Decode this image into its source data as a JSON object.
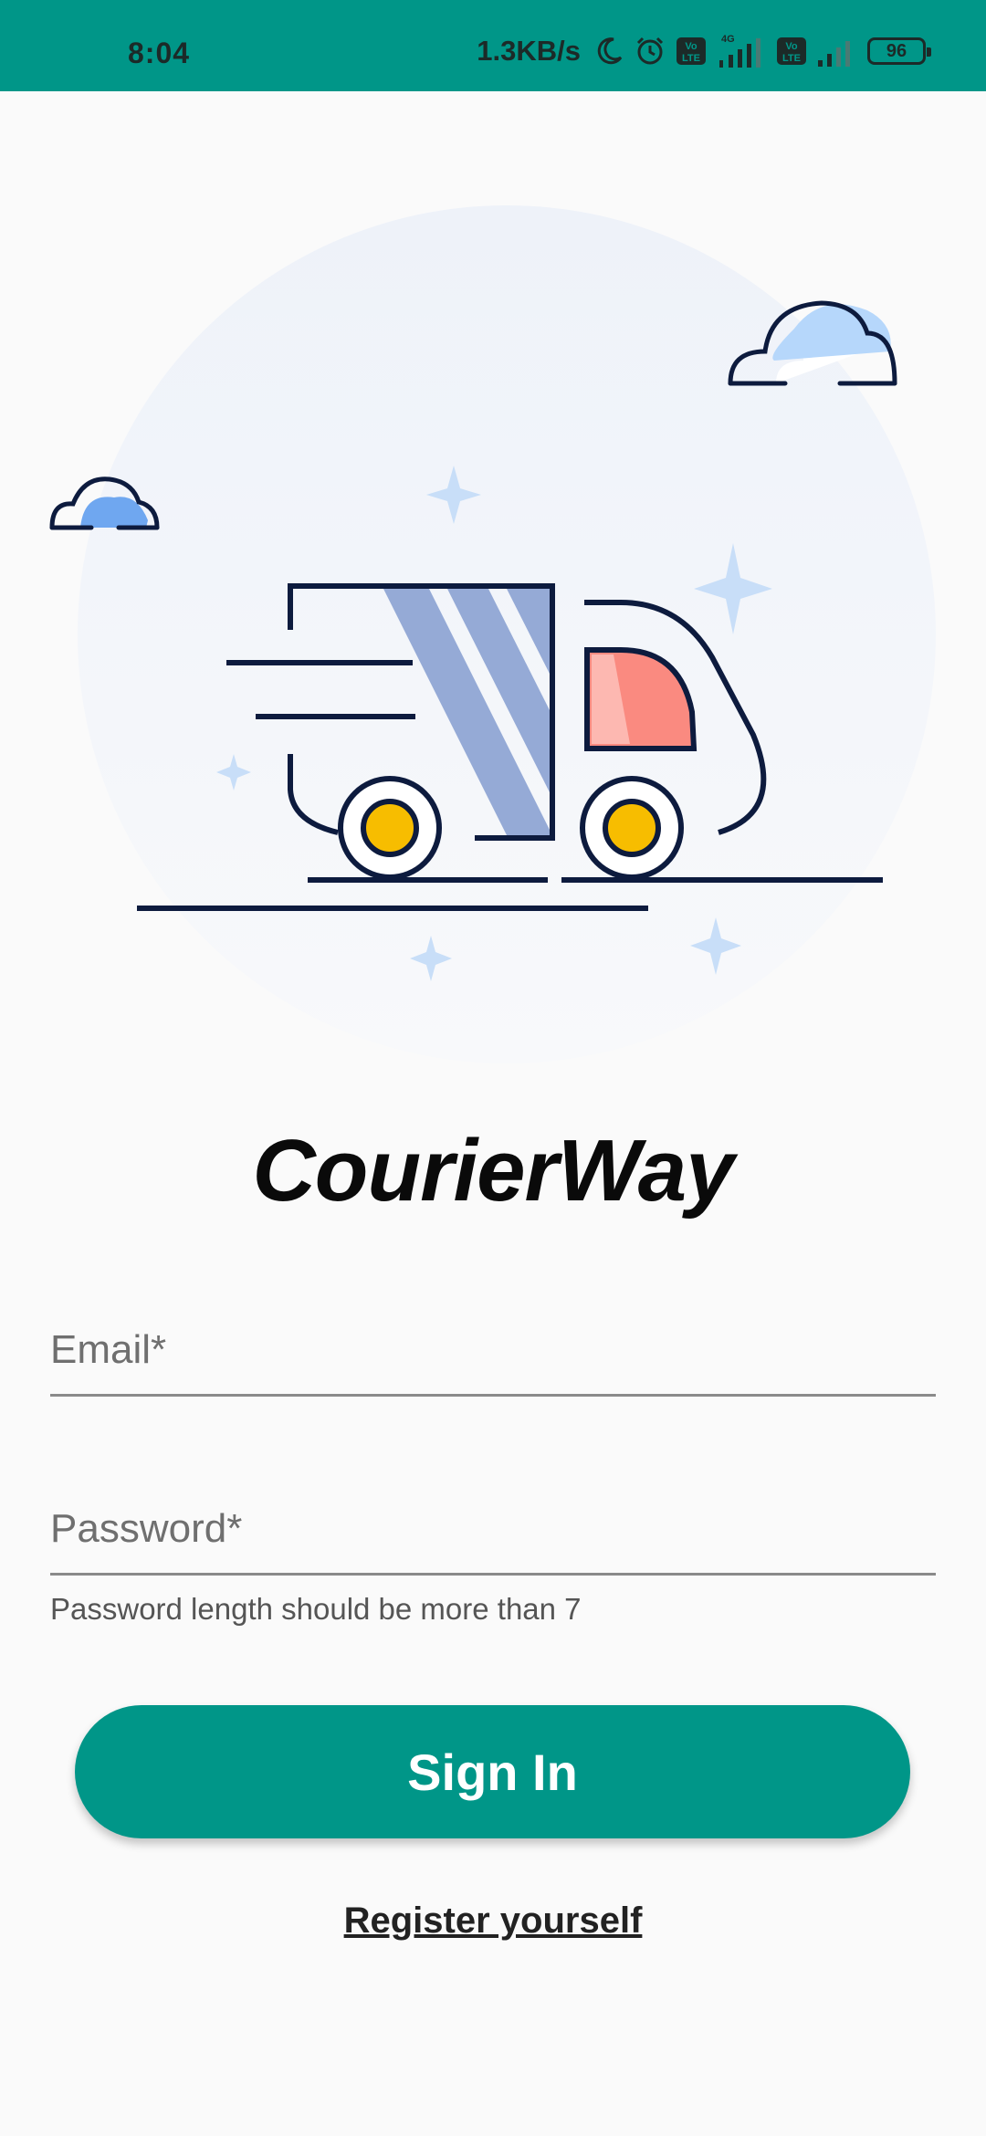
{
  "status_bar": {
    "time": "8:04",
    "net_speed": "1.3KB/s",
    "icons": [
      "moon-icon",
      "alarm-icon",
      "volte-icon",
      "signal-4g-icon",
      "volte-icon",
      "signal-icon"
    ],
    "network_label": "4G",
    "volte_label": "Vo\nLTE",
    "battery": "96"
  },
  "illustration": {
    "name": "delivery-truck-illustration",
    "colors": {
      "circle": "#eef2f8",
      "outline": "#0d1b3e",
      "stripes": "#95aad6",
      "cab_window": "#fa8a80",
      "cab_window_light": "#fdb8b1",
      "wheel_hub": "#f7bd00",
      "cloud_fill": "#b6d7fb",
      "sparkle": "#c8def8"
    }
  },
  "brand": {
    "title": "CourierWay"
  },
  "form": {
    "email_placeholder": "Email*",
    "password_placeholder": "Password*",
    "password_helper": "Password length should be more than 7"
  },
  "actions": {
    "sign_in": "Sign In",
    "register": "Register yourself"
  },
  "colors": {
    "primary": "#009688",
    "background": "#fafafa"
  }
}
